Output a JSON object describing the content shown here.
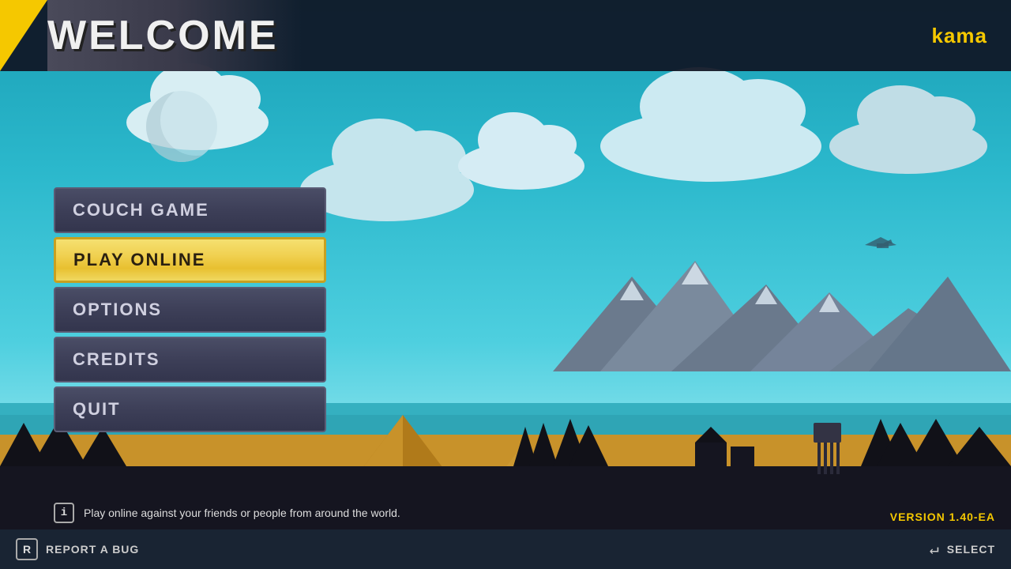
{
  "header": {
    "title": "WELCOME",
    "username": "kama"
  },
  "menu": {
    "items": [
      {
        "id": "couch-game",
        "label": "COUCH GAME",
        "selected": false
      },
      {
        "id": "play-online",
        "label": "PLAY ONLINE",
        "selected": true
      },
      {
        "id": "options",
        "label": "OPTIONS",
        "selected": false
      },
      {
        "id": "credits",
        "label": "CREDITS",
        "selected": false
      },
      {
        "id": "quit",
        "label": "QUIT",
        "selected": false
      }
    ]
  },
  "info": {
    "description": "Play online against your friends or people from around the world."
  },
  "footer": {
    "report_bug_key": "R",
    "report_bug_label": "REPORT A BUG",
    "select_label": "SELECT"
  },
  "version": "VERSION 1.40-EA",
  "colors": {
    "selected_bg": "#f0d050",
    "default_bg": "#3d3f58",
    "header_bg": "#0f1423",
    "accent_yellow": "#f5c800"
  }
}
